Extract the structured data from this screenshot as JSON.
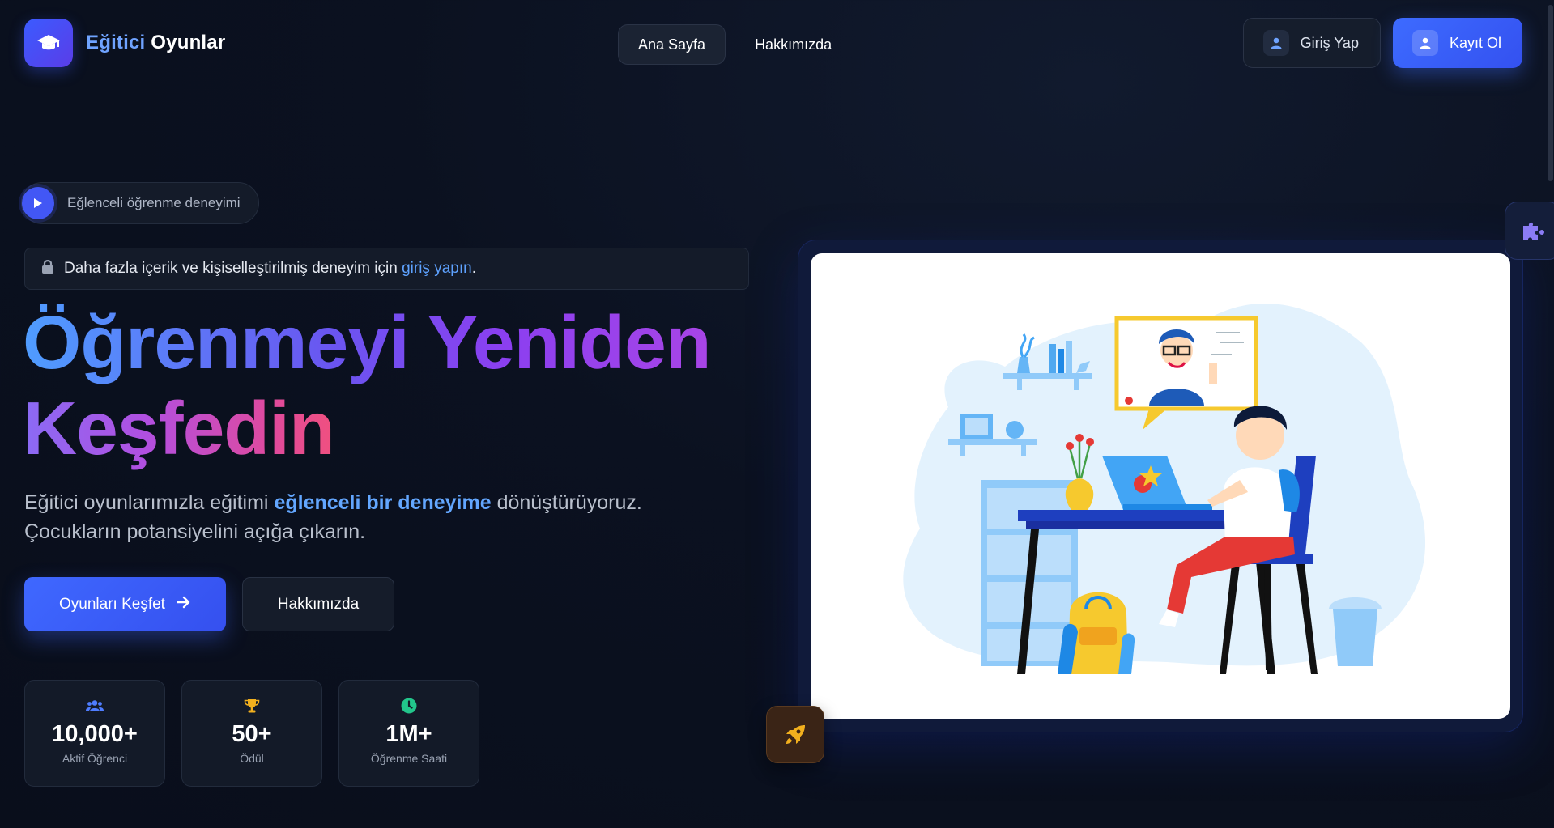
{
  "header": {
    "logo_icon": "graduation-cap-icon",
    "logo_part1": "Eğitici",
    "logo_part2": "Oyunlar",
    "nav": [
      {
        "label": "Ana Sayfa",
        "active": true
      },
      {
        "label": "Hakkımızda",
        "active": false
      }
    ],
    "login_label": "Giriş Yap",
    "login_icon": "user-icon",
    "register_label": "Kayıt Ol",
    "register_icon": "user-icon"
  },
  "hero": {
    "pill_icon": "play-icon",
    "pill_text": "Eğlenceli öğrenme deneyimi",
    "notice_icon": "lock-icon",
    "notice_text": "Daha fazla içerik ve kişiselleştirilmiş deneyim için",
    "notice_link": "giriş yapın",
    "notice_end": ".",
    "title_line1": "Öğrenmeyi Yeniden",
    "title_line2": "Keşfedin",
    "subtitle_start": "Eğitici oyunlarımızla eğitimi",
    "subtitle_highlight": "eğlenceli bir deneyime",
    "subtitle_end": "dönüştürüyoruz.",
    "subtitle_line2": "Çocukların potansiyelini açığa çıkarın.",
    "primary_button": "Oyunları Keşfet",
    "primary_icon": "arrow-right-icon",
    "secondary_button": "Hakkımızda"
  },
  "stats": [
    {
      "icon": "users-icon",
      "value": "10,000+",
      "label": "Aktif Öğrenci",
      "color": "#4f7dff"
    },
    {
      "icon": "trophy-icon",
      "value": "50+",
      "label": "Ödül",
      "color": "#f2b01e"
    },
    {
      "icon": "clock-icon",
      "value": "1M+",
      "label": "Öğrenme Saati",
      "color": "#22c58b"
    }
  ],
  "decor": {
    "rocket_icon": "rocket-icon",
    "puzzle_icon": "puzzle-icon",
    "illustration": "student-online-learning-illustration"
  },
  "colors": {
    "accent": "#3d6bff",
    "link": "#5ea2ff",
    "background": "#0b1120"
  }
}
